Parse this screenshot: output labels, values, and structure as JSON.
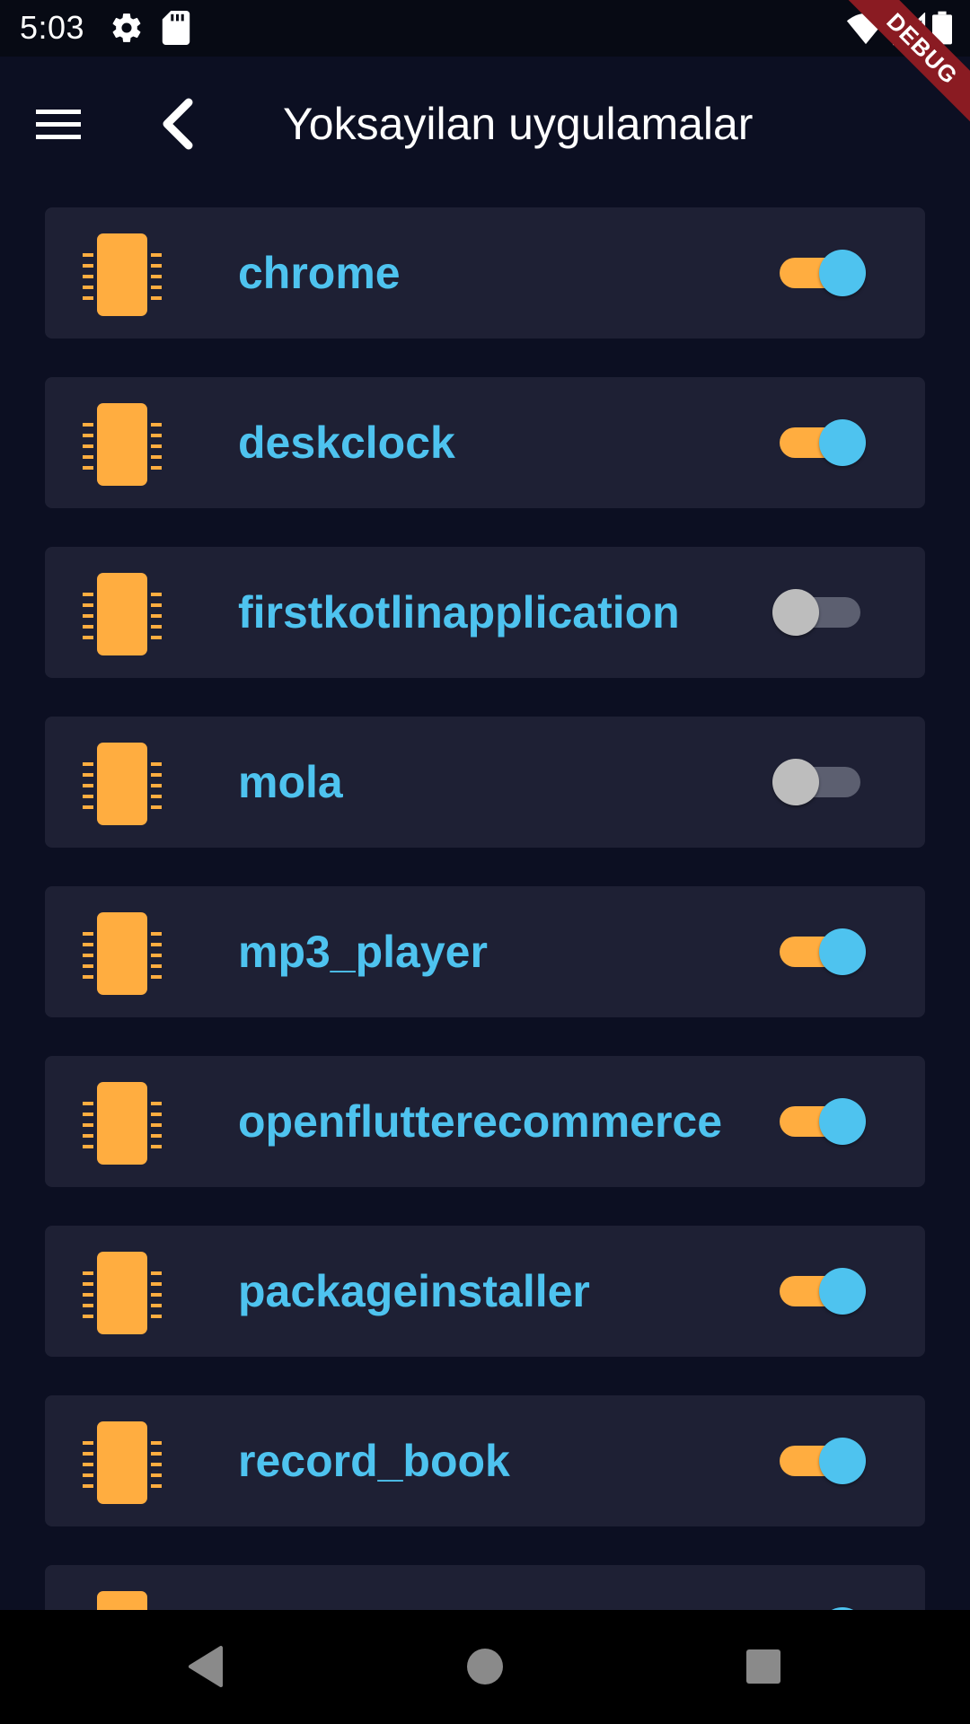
{
  "status_bar": {
    "time": "5:03",
    "icons": [
      "gear-icon",
      "sd-card-icon",
      "wifi-icon",
      "signal-icon",
      "battery-icon"
    ],
    "debug_banner": "DEBUG"
  },
  "app_bar": {
    "title": "Yoksayilan uygulamalar",
    "menu_icon": "menu-icon",
    "back_icon": "back-icon"
  },
  "colors": {
    "background": "#0c0f22",
    "card": "#1e2034",
    "accent_blue": "#4ec3ef",
    "accent_orange": "#ffad40",
    "toggle_off_track": "#5c5f70",
    "toggle_off_thumb": "#bdbdbd"
  },
  "apps": [
    {
      "name": "chrome",
      "enabled": true,
      "icon": "chip-icon"
    },
    {
      "name": "deskclock",
      "enabled": true,
      "icon": "chip-icon"
    },
    {
      "name": "firstkotlinapplication",
      "enabled": false,
      "icon": "chip-icon"
    },
    {
      "name": "mola",
      "enabled": false,
      "icon": "chip-icon"
    },
    {
      "name": "mp3_player",
      "enabled": true,
      "icon": "chip-icon"
    },
    {
      "name": "openflutterecommerce",
      "enabled": true,
      "icon": "chip-icon"
    },
    {
      "name": "packageinstaller",
      "enabled": true,
      "icon": "chip-icon"
    },
    {
      "name": "record_book",
      "enabled": true,
      "icon": "chip-icon"
    },
    {
      "name": "",
      "enabled": true,
      "icon": "chip-icon"
    }
  ],
  "nav_bar": {
    "buttons": [
      "back-nav-icon",
      "home-nav-icon",
      "recents-nav-icon"
    ]
  }
}
